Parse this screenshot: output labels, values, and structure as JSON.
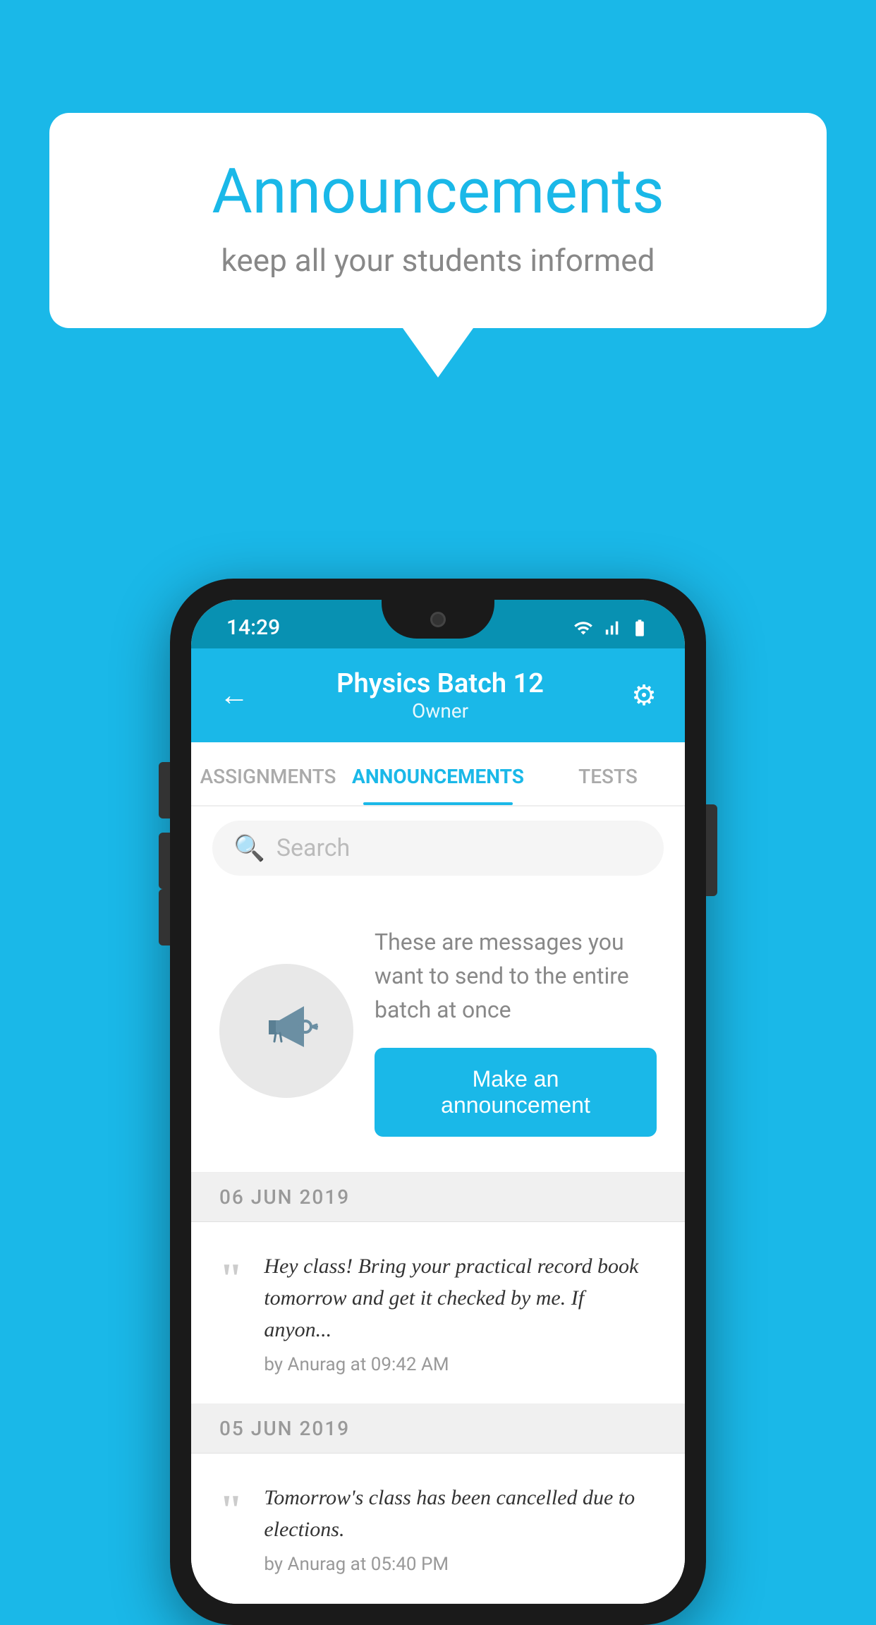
{
  "background": {
    "color": "#1ab8e8"
  },
  "speech_bubble": {
    "title": "Announcements",
    "subtitle": "keep all your students informed"
  },
  "phone": {
    "status_bar": {
      "time": "14:29"
    },
    "app_bar": {
      "title": "Physics Batch 12",
      "subtitle": "Owner",
      "back_label": "←",
      "gear_label": "⚙"
    },
    "tabs": [
      {
        "label": "ASSIGNMENTS",
        "active": false
      },
      {
        "label": "ANNOUNCEMENTS",
        "active": true
      },
      {
        "label": "TESTS",
        "active": false
      }
    ],
    "search": {
      "placeholder": "Search"
    },
    "announcement_prompt": {
      "description_text": "These are messages you want to send to the entire batch at once",
      "button_label": "Make an announcement"
    },
    "messages": [
      {
        "date": "06  JUN  2019",
        "text": "Hey class! Bring your practical record book tomorrow and get it checked by me. If anyon...",
        "meta": "by Anurag at 09:42 AM"
      },
      {
        "date": "05  JUN  2019",
        "text": "Tomorrow's class has been cancelled due to elections.",
        "meta": "by Anurag at 05:40 PM"
      }
    ]
  }
}
